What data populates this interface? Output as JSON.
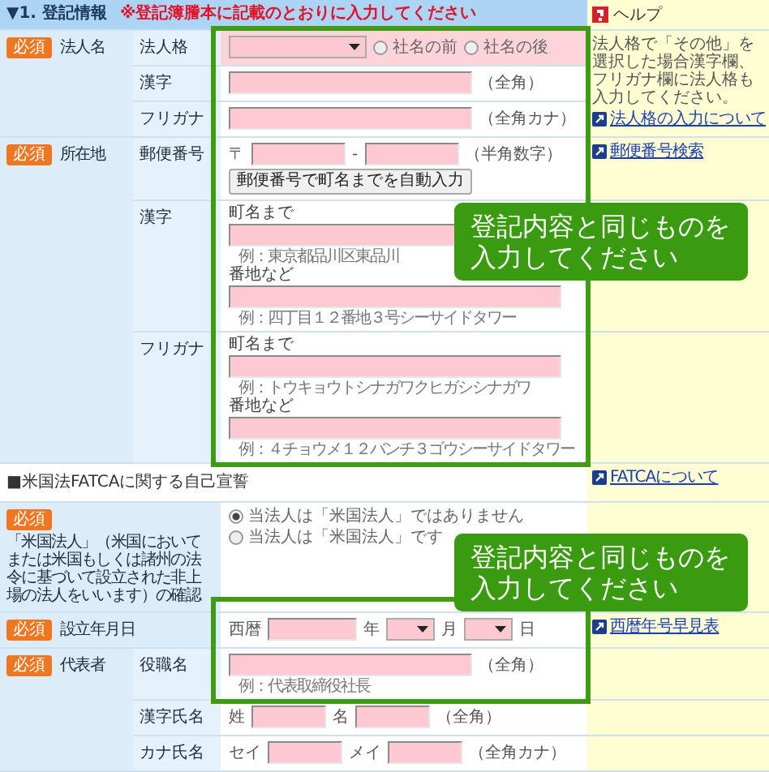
{
  "section": {
    "title": "▼1. 登記情報",
    "note": "※登記簿謄本に記載のとおりに入力してください"
  },
  "help_title": "ヘルプ",
  "blocks": [
    {
      "kind": "group",
      "badge": "必須",
      "label": "法人名",
      "help": {
        "text": "法人格で「その他」を選択した場合漢字欄、フリガナ欄に法人格も入力してください。",
        "link": "法人格の入力について"
      },
      "rows": [
        {
          "label": "法人格",
          "highlighted": true,
          "parts": [
            {
              "kind": "select"
            },
            {
              "kind": "radio",
              "label": "社名の前",
              "selected": false
            },
            {
              "kind": "radio",
              "label": "社名の後",
              "selected": false
            }
          ]
        },
        {
          "label": "漢字",
          "highlighted": false,
          "parts": [
            {
              "kind": "text-input"
            },
            {
              "kind": "note",
              "text": "（全角）"
            }
          ]
        },
        {
          "label": "フリガナ",
          "highlighted": false,
          "parts": [
            {
              "kind": "text-input"
            },
            {
              "kind": "note",
              "text": "（全角カナ）"
            }
          ]
        }
      ]
    },
    {
      "kind": "group",
      "badge": "必須",
      "label": "所在地",
      "rows": [
        {
          "label": "郵便番号",
          "highlighted": false,
          "help": {
            "link": "郵便番号検索"
          },
          "parts": [
            {
              "kind": "note",
              "text": "〒"
            },
            {
              "kind": "zip-input"
            },
            {
              "kind": "note",
              "text": "-"
            },
            {
              "kind": "zip-input"
            },
            {
              "kind": "note",
              "text": "（半角数字）"
            },
            {
              "kind": "break"
            },
            {
              "kind": "button",
              "text": "郵便番号で町名までを自動入力"
            }
          ]
        },
        {
          "label": "漢字",
          "highlighted": false,
          "parts": [
            {
              "kind": "caption",
              "text": "町名まで"
            },
            {
              "kind": "address-input"
            },
            {
              "kind": "hint",
              "text": "例：東京都品川区東品川"
            },
            {
              "kind": "caption",
              "text": "番地など"
            },
            {
              "kind": "address-input"
            },
            {
              "kind": "hint",
              "text": "例：四丁目１２番地３号シーサイドタワー"
            }
          ]
        },
        {
          "label": "フリガナ",
          "highlighted": false,
          "parts": [
            {
              "kind": "caption",
              "text": "町名まで"
            },
            {
              "kind": "address-input"
            },
            {
              "kind": "hint",
              "text": "例：トウキョウトシナガワクヒガシシナガワ"
            },
            {
              "kind": "caption",
              "text": "番地など"
            },
            {
              "kind": "address-input"
            },
            {
              "kind": "hint",
              "text": "例：４チョウメ１２バンチ３ゴウシーサイドタワー"
            }
          ]
        }
      ]
    },
    {
      "kind": "heading",
      "text": "■米国法FATCAに関する自己宣誓",
      "help": {
        "link": "FATCAについて"
      }
    },
    {
      "kind": "single",
      "badge": "必須",
      "label": "「米国法人」（米国においてまたは米国もしくは諸州の法令に基づいて設立された非上場の法人をいいます）の確認",
      "parts": [
        {
          "kind": "radio",
          "label": "当法人は「米国法人」ではありません",
          "selected": true
        },
        {
          "kind": "break"
        },
        {
          "kind": "radio",
          "label": "当法人は「米国法人」です",
          "selected": false
        }
      ]
    },
    {
      "kind": "single",
      "badge": "必須",
      "label": "設立年月日",
      "help": {
        "link": "西暦年号早見表"
      },
      "parts": [
        {
          "kind": "note",
          "text": "西暦"
        },
        {
          "kind": "year-input"
        },
        {
          "kind": "note",
          "text": "年"
        },
        {
          "kind": "short-select"
        },
        {
          "kind": "note",
          "text": "月"
        },
        {
          "kind": "short-select"
        },
        {
          "kind": "note",
          "text": "日"
        }
      ]
    },
    {
      "kind": "group",
      "badge": "必須",
      "label": "代表者",
      "rows": [
        {
          "label": "役職名",
          "highlighted": false,
          "parts": [
            {
              "kind": "text-input"
            },
            {
              "kind": "note",
              "text": "（全角）"
            },
            {
              "kind": "hint",
              "text": "例：代表取締役社長"
            }
          ]
        },
        {
          "label": "漢字氏名",
          "highlighted": false,
          "parts": [
            {
              "kind": "note",
              "text": "姓"
            },
            {
              "kind": "name-input"
            },
            {
              "kind": "note",
              "text": "名"
            },
            {
              "kind": "name-input"
            },
            {
              "kind": "note",
              "text": "（全角）"
            }
          ]
        },
        {
          "label": "カナ氏名",
          "highlighted": false,
          "parts": [
            {
              "kind": "note",
              "text": "セイ"
            },
            {
              "kind": "name-input"
            },
            {
              "kind": "note",
              "text": "メイ"
            },
            {
              "kind": "name-input"
            },
            {
              "kind": "note",
              "text": "（全角カナ）"
            }
          ]
        }
      ]
    }
  ],
  "callouts": [
    {
      "text": "登記内容と同じものを入力してください"
    },
    {
      "text": "登記内容と同じものを入力してください"
    }
  ]
}
